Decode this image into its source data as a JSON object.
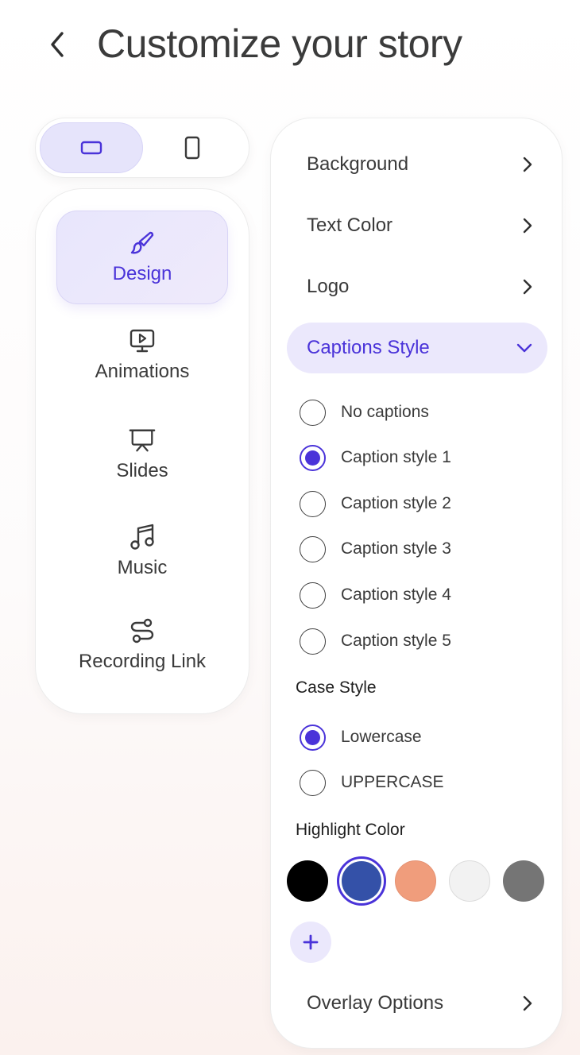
{
  "header": {
    "title": "Customize your story"
  },
  "orientation": {
    "selected": "landscape"
  },
  "nav": {
    "items": [
      {
        "label": "Design",
        "icon": "brush-icon"
      },
      {
        "label": "Animations",
        "icon": "monitor-play-icon"
      },
      {
        "label": "Slides",
        "icon": "presentation-icon"
      },
      {
        "label": "Music",
        "icon": "music-note-icon"
      },
      {
        "label": "Recording Link",
        "icon": "route-icon"
      }
    ],
    "active": "Design"
  },
  "panel": {
    "background_label": "Background",
    "text_color_label": "Text Color",
    "logo_label": "Logo",
    "captions_style_label": "Captions Style",
    "captions_options": [
      "No captions",
      "Caption style 1",
      "Caption style 2",
      "Caption style 3",
      "Caption style 4",
      "Caption style 5"
    ],
    "captions_selected": "Caption style 1",
    "case_style_title": "Case Style",
    "case_options": [
      "Lowercase",
      "UPPERCASE"
    ],
    "case_selected": "Lowercase",
    "highlight_title": "Highlight Color",
    "highlight_colors": [
      "#000000",
      "#3451a8",
      "#f09d7c",
      "#f2f2f2",
      "#757575"
    ],
    "highlight_selected": "#3451a8",
    "overlay_label": "Overlay Options"
  },
  "colors": {
    "accent": "#4a33d9",
    "accent_soft": "#ebe8fc"
  }
}
